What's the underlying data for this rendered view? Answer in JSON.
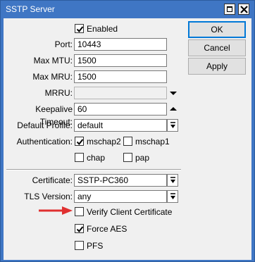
{
  "window": {
    "title": "SSTP Server",
    "maximize_icon": "maximize-icon",
    "close_icon": "close-icon",
    "title_color": "#3f76c4"
  },
  "form": {
    "enabled": {
      "label": "Enabled",
      "checked": true
    },
    "port": {
      "label": "Port:",
      "value": "10443"
    },
    "max_mtu": {
      "label": "Max MTU:",
      "value": "1500"
    },
    "max_mru": {
      "label": "Max MRU:",
      "value": "1500"
    },
    "mrru": {
      "label": "MRRU:",
      "value": ""
    },
    "keepalive": {
      "label": "Keepalive Timeout:",
      "value": "60"
    },
    "default_profile": {
      "label": "Default Profile:",
      "value": "default"
    },
    "authentication": {
      "label": "Authentication:",
      "options": [
        {
          "label": "mschap2",
          "checked": true
        },
        {
          "label": "mschap1",
          "checked": false
        },
        {
          "label": "chap",
          "checked": false
        },
        {
          "label": "pap",
          "checked": false
        }
      ]
    },
    "certificate": {
      "label": "Certificate:",
      "value": "SSTP-PC360"
    },
    "tls_version": {
      "label": "TLS Version:",
      "value": "any"
    },
    "verify_client_certificate": {
      "label": "Verify Client Certificate",
      "checked": false
    },
    "force_aes": {
      "label": "Force AES",
      "checked": true
    },
    "pfs": {
      "label": "PFS",
      "checked": false
    }
  },
  "buttons": {
    "ok": "OK",
    "cancel": "Cancel",
    "apply": "Apply"
  },
  "annotation": {
    "arrow_color": "#e03030"
  }
}
